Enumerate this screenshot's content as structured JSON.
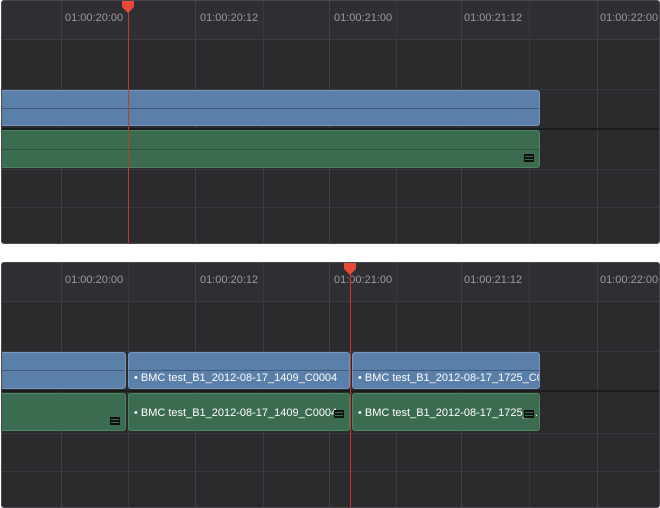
{
  "timeline_top": {
    "timecodes": [
      "01:00:20:00",
      "01:00:20:12",
      "01:00:21:00",
      "01:00:21:12",
      "01:00:22:00"
    ]
  },
  "timeline_bottom": {
    "timecodes": [
      "01:00:20:00",
      "01:00:20:12",
      "01:00:21:00",
      "01:00:21:12",
      "01:00:22:00"
    ],
    "video_clips": [
      {
        "label": "BMC test_B1_2012-08-17_1409_C0004"
      },
      {
        "label": "BMC test_B1_2012-08-17_1725_C0..."
      }
    ],
    "audio_clips": [
      {
        "label": "BMC test_B1_2012-08-17_1409_C0004"
      },
      {
        "label": "BMC test_B1_2012-08-17_1725_..."
      }
    ]
  },
  "colors": {
    "video_clip": "#5a7fa9",
    "audio_clip": "#3b6c50",
    "playhead": "#c0392b",
    "playhead_marker": "#e8483a"
  },
  "icons": {
    "playhead": "playhead-marker-icon",
    "audio_clip": "audio-waveform-icon"
  }
}
